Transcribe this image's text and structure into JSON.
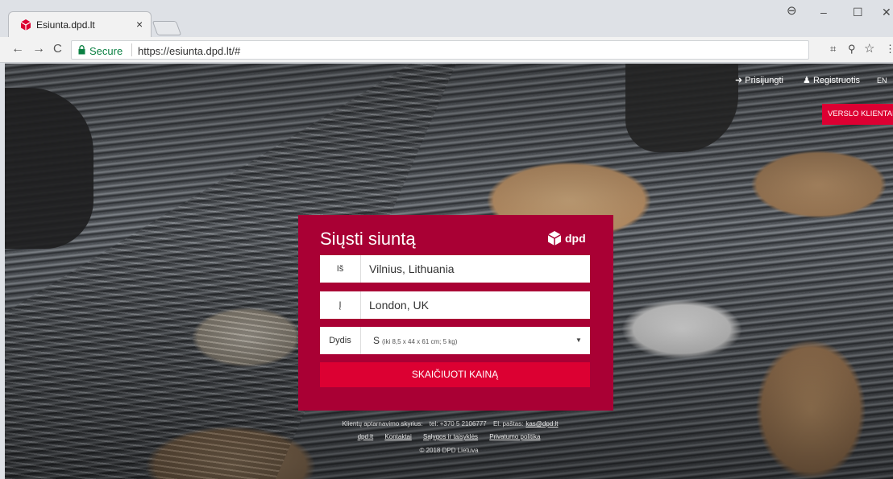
{
  "browser": {
    "tab_title": "Esiunta.dpd.lt",
    "tab_close": "×",
    "secure_label": "Secure",
    "url": "https://esiunta.dpd.lt/#",
    "nav_back": "←",
    "nav_forward": "→",
    "nav_reload": "C",
    "translate_icon": "⌗",
    "zoom_icon": "⚲",
    "star_icon": "☆",
    "menu_icon": "⋮",
    "window_user": "⊖",
    "window_minimize": "–",
    "window_maximize": "☐",
    "window_close": "✕"
  },
  "header": {
    "login": "Prisijungti",
    "register": "Registruotis",
    "language": "EN",
    "business_button": "VERSLO KLIENTAMS"
  },
  "form": {
    "title": "Siųsti siuntą",
    "brand": "dpd",
    "from_label": "Iš",
    "from_value": "Vilnius, Lithuania",
    "to_label": "Į",
    "to_value": "London, UK",
    "size_label": "Dydis",
    "size_value": "S",
    "size_detail": "(iki 8,5 x 44 x 61 cm; 5 kg)",
    "calculate_button": "SKAIČIUOTI KAINĄ"
  },
  "footer": {
    "support_label": "Klientų aptarnavimo skyrius:",
    "phone": "tel: +370 5 2106777",
    "email_label": "El. paštas:",
    "email": "kas@dpd.lt",
    "links": [
      "dpd.lt",
      "Kontaktai",
      "Sąlygos ir taisyklės",
      "Privatumo politika"
    ],
    "copyright": "© 2018 DPD Lietuva"
  },
  "colors": {
    "card_background": "#a90034",
    "accent_red": "#dc0032",
    "secure_green": "#0b8043"
  }
}
